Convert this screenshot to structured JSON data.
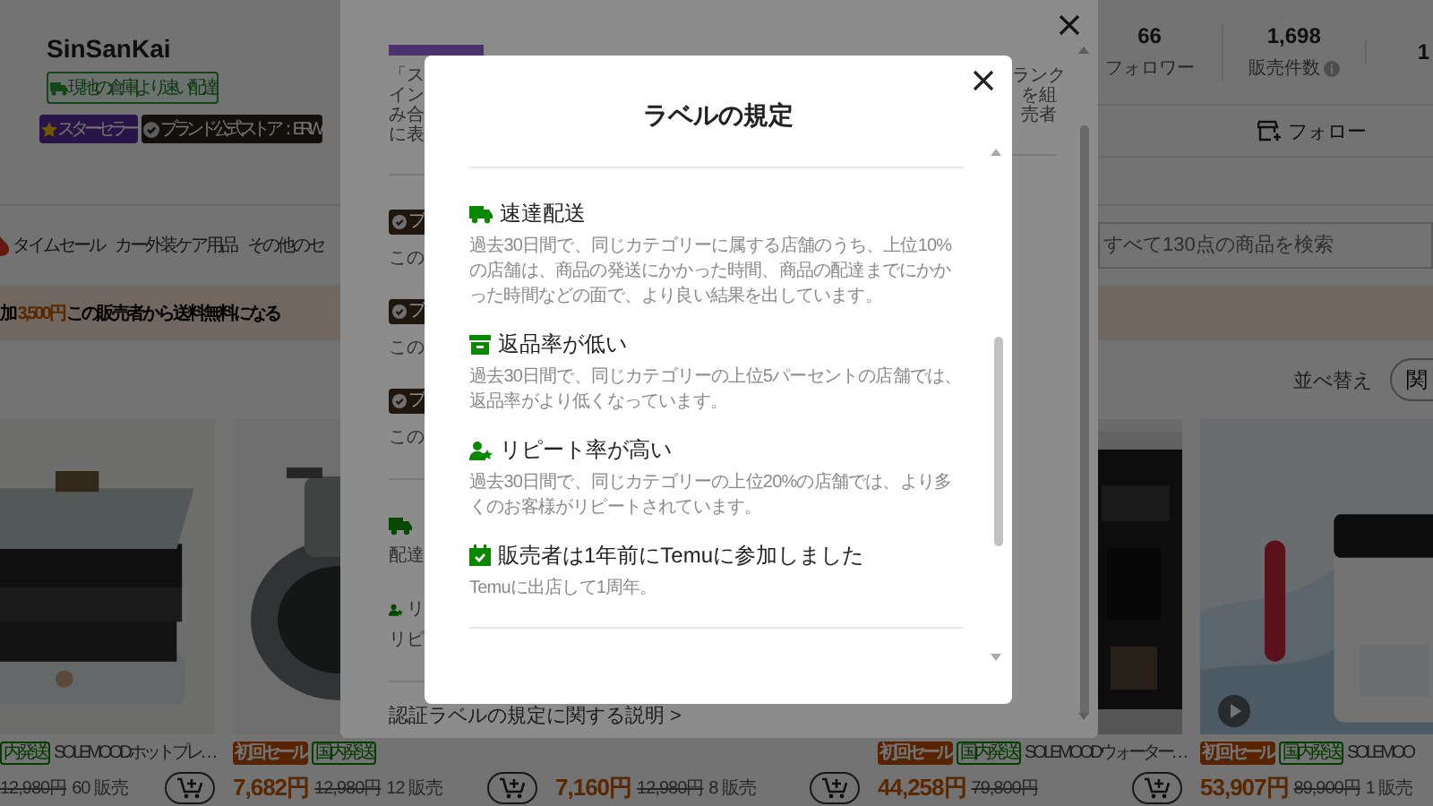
{
  "shop": {
    "name": "SinSanKai",
    "badge_rows": [
      [
        {
          "kind": "warehouse",
          "text": "現地の倉庫 | より速い配達"
        }
      ],
      [
        {
          "kind": "star",
          "text": "スターセラー"
        },
        {
          "kind": "brand",
          "text": "ブランド公式ストア：ERW"
        }
      ]
    ]
  },
  "stats": [
    {
      "value": "66",
      "label": "フォロワー"
    },
    {
      "value": "1,698",
      "label": "販売件数",
      "info": true
    },
    {
      "value": "1"
    }
  ],
  "follow": {
    "label": "フォロー"
  },
  "nav": {
    "tabs": [
      {
        "label": "タイムセール",
        "icon": true
      },
      {
        "label": "カー外装ケア用品"
      },
      {
        "label": "その他のセ"
      }
    ],
    "search": {
      "placeholder": "すべて130点の商品を検索"
    }
  },
  "banner": {
    "lead": "加",
    "amount": "3,500円",
    "rest": "この販売者から送料無料になる"
  },
  "sort": {
    "label": "並べ替え",
    "option": "関"
  },
  "products": [
    {
      "media": {
        "kind": "picture"
      },
      "tags": [
        {
          "kind": "domestic",
          "text": "内発送"
        }
      ],
      "name": "SOLEMOODホットプレ…",
      "list_price": "12,980円",
      "sold": "60 販売",
      "cart": true
    },
    {
      "media": {
        "kind": "picture"
      },
      "tags": [
        {
          "kind": "sale",
          "text": "初回セール"
        },
        {
          "kind": "domestic",
          "text": "国内発送"
        }
      ],
      "price": "7,682円",
      "list_price": "12,980円",
      "sold": "12 販売",
      "cart": true
    },
    {
      "price": "7,160円",
      "list_price": "12,980円",
      "sold": "8 販売",
      "cart": true
    },
    {
      "media": {
        "kind": "picture"
      },
      "tags": [
        {
          "kind": "sale",
          "text": "初回セール"
        },
        {
          "kind": "domestic",
          "text": "国内発送"
        }
      ],
      "name": "SOLEMOODウォーター…",
      "price": "44,258円",
      "list_price": "79,800円",
      "cart": true
    },
    {
      "media": {
        "kind": "picture",
        "video": true
      },
      "tags": [
        {
          "kind": "sale",
          "text": "初回セール"
        },
        {
          "kind": "domestic",
          "text": "国内発送"
        }
      ],
      "name": "SOLEMOO",
      "price": "53,907円",
      "list_price": "89,900円",
      "sold": "1 販売"
    }
  ],
  "badge_dialog": {
    "intro_left": [
      "「ス",
      "イン",
      "み合",
      "に表"
    ],
    "intro_right": [
      "ランク",
      "を組",
      "売者"
    ],
    "brand_rows": [
      {
        "badge": "ブ",
        "text": "この"
      },
      {
        "badge": "ブ",
        "text": "この"
      },
      {
        "badge": "ブ",
        "text": "この"
      }
    ],
    "label_rows": [
      {
        "kind": "fast",
        "text": "配達"
      },
      {
        "kind": "repeat",
        "title": "リ",
        "text": "リピ"
      }
    ],
    "link": "認証ラベルの規定に関する説明 >"
  },
  "rules_dialog": {
    "title": "ラベルの規定",
    "rules": [
      {
        "kind": "fast",
        "title": "速達配送",
        "text": "過去30日間で、同じカテゴリーに属する店舗のうち、上位10%の店舗は、商品の発送にかかった時間、商品の配達までにかかった時間などの面で、より良い結果を出しています。"
      },
      {
        "kind": "returns",
        "title": "返品率が低い",
        "text": "過去30日間で、同じカテゴリーの上位5パーセントの店舗では、返品率がより低くなっています。"
      },
      {
        "kind": "repeat",
        "title": "リピート率が高い",
        "text": "過去30日間で、同じカテゴリーの上位20%の店舗では、より多くのお客様がリピートされています。"
      },
      {
        "kind": "tenure",
        "title": "販売者は1年前にTemuに参加しました",
        "text": "Temuに出店して1周年。"
      }
    ]
  }
}
